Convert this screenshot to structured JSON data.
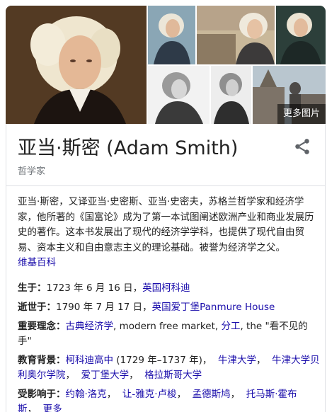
{
  "gallery": {
    "more_photos_label": "更多图片"
  },
  "header": {
    "title": "亚当·斯密 (Adam Smith)",
    "subtitle": "哲学家"
  },
  "description": {
    "text": "亚当·斯密，又译亚当·史密斯、亚当·史密夫，苏格兰哲学家和经济学家，他所著的《国富论》成为了第一本试图阐述欧洲产业和商业发展历史的著作。这本书发展出了现代的经济学学科，也提供了现代自由贸易、资本主义和自由意志主义的理论基础。被誉为经济学之父。",
    "source_link": "维基百科"
  },
  "facts": {
    "born": {
      "label": "生于：",
      "value": "1723 年 6 月 16 日，",
      "link": "英国柯科迪"
    },
    "died": {
      "label": "逝世于：",
      "value": "1790 年 7 月 17 日，",
      "link": "英国爱丁堡Panmure House"
    },
    "ideas": {
      "label": "重要理念：",
      "items": [
        "古典经济学",
        "modern free market",
        "分工",
        "the \"看不见的手\""
      ],
      "separators": [
        ", ",
        ", ",
        ", "
      ]
    },
    "education": {
      "label": "教育背景：",
      "items": [
        "柯科迪高中",
        "牛津大学",
        "牛津大学贝利奥尔学院",
        "爱丁堡大学",
        "格拉斯哥大学"
      ],
      "plain": "(1729 年–1737 年)，"
    },
    "influenced_by": {
      "label": "受影响于：",
      "items": [
        "约翰·洛克",
        "让-雅克·卢梭",
        "孟德斯鸠",
        "托马斯·霍布斯",
        "更多"
      ]
    }
  }
}
